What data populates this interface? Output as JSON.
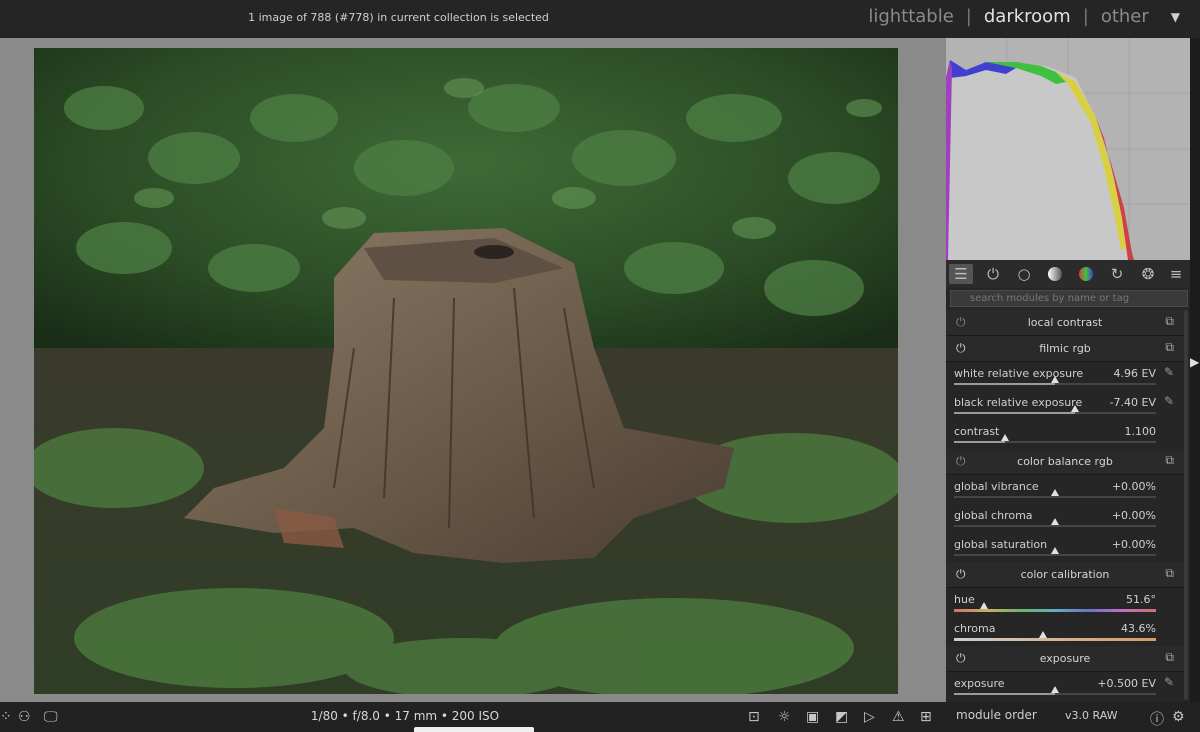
{
  "topbar": {
    "status": "1 image of 788 (#778) in current collection is selected",
    "views": [
      "lighttable",
      "darkroom",
      "other"
    ],
    "active_view": "darkroom",
    "menu_icon": "triangle-down-icon"
  },
  "bottombar": {
    "exif": "1/80 • f/8.0 • 17 mm • 200 ISO",
    "module_order_label": "module order",
    "module_order_value": "v3.0 RAW"
  },
  "panel": {
    "search_placeholder": "search modules by name or tag",
    "tabs": [
      "presets-icon",
      "power-icon",
      "circle-icon",
      "gradient-sphere-icon",
      "color-wheel-icon",
      "correct-icon",
      "aperture-icon",
      "menu-icon"
    ],
    "modules": [
      {
        "name": "local contrast",
        "enabled": false,
        "sliders": []
      },
      {
        "name": "filmic rgb",
        "enabled": true,
        "sliders": [
          {
            "label": "white relative exposure",
            "value": "4.96 EV",
            "pos": 0.5,
            "picker": true
          },
          {
            "label": "black relative exposure",
            "value": "-7.40 EV",
            "pos": 0.6,
            "picker": true
          },
          {
            "label": "contrast",
            "value": "1.100",
            "pos": 0.25,
            "picker": false
          }
        ]
      },
      {
        "name": "color balance rgb",
        "enabled": false,
        "sliders": [
          {
            "label": "global vibrance",
            "value": "+0.00%",
            "pos": 0.5,
            "picker": false
          },
          {
            "label": "global chroma",
            "value": "+0.00%",
            "pos": 0.5,
            "picker": false
          },
          {
            "label": "global saturation",
            "value": "+0.00%",
            "pos": 0.5,
            "picker": false
          }
        ]
      },
      {
        "name": "color calibration",
        "enabled": true,
        "sliders": [
          {
            "label": "hue",
            "value": "51.6°",
            "pos": 0.15,
            "picker": false
          },
          {
            "label": "chroma",
            "value": "43.6%",
            "pos": 0.44,
            "picker": false
          }
        ]
      },
      {
        "name": "exposure",
        "enabled": true,
        "sliders": [
          {
            "label": "exposure",
            "value": "+0.500 EV",
            "pos": 0.5,
            "picker": true
          }
        ]
      }
    ]
  },
  "colors": {
    "accent": "#e0e0e0",
    "panel": "#262626",
    "center": "#8a8a8a"
  }
}
